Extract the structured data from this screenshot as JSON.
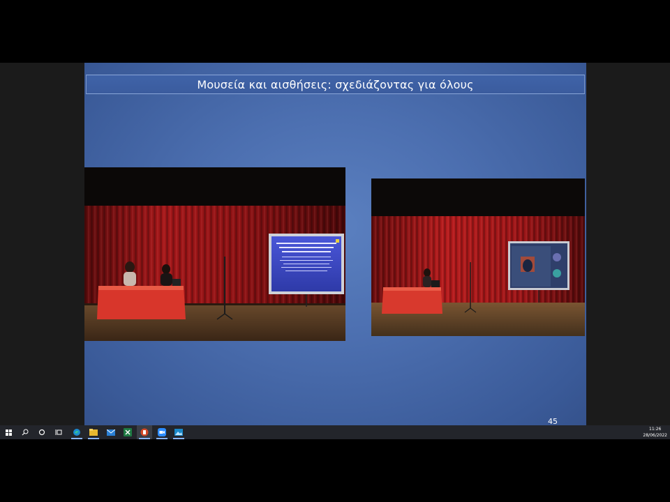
{
  "slide": {
    "title": "Μουσεία και αισθήσεις: σχεδιάζοντας για όλους",
    "page_number": "45"
  },
  "taskbar": {
    "icons": [
      "windows-start-icon",
      "search-icon",
      "cortana-icon",
      "task-view-icon",
      "edge-icon",
      "file-explorer-icon",
      "mail-icon",
      "excel-icon",
      "powerpoint-icon",
      "zoom-icon",
      "photos-icon"
    ],
    "time": "11:26",
    "date": "28/06/2022"
  },
  "colors": {
    "slide_bg": "#4c6fb0",
    "curtain": "#a4161a",
    "table_cloth": "#d6352a",
    "taskbar": "#23252b"
  }
}
